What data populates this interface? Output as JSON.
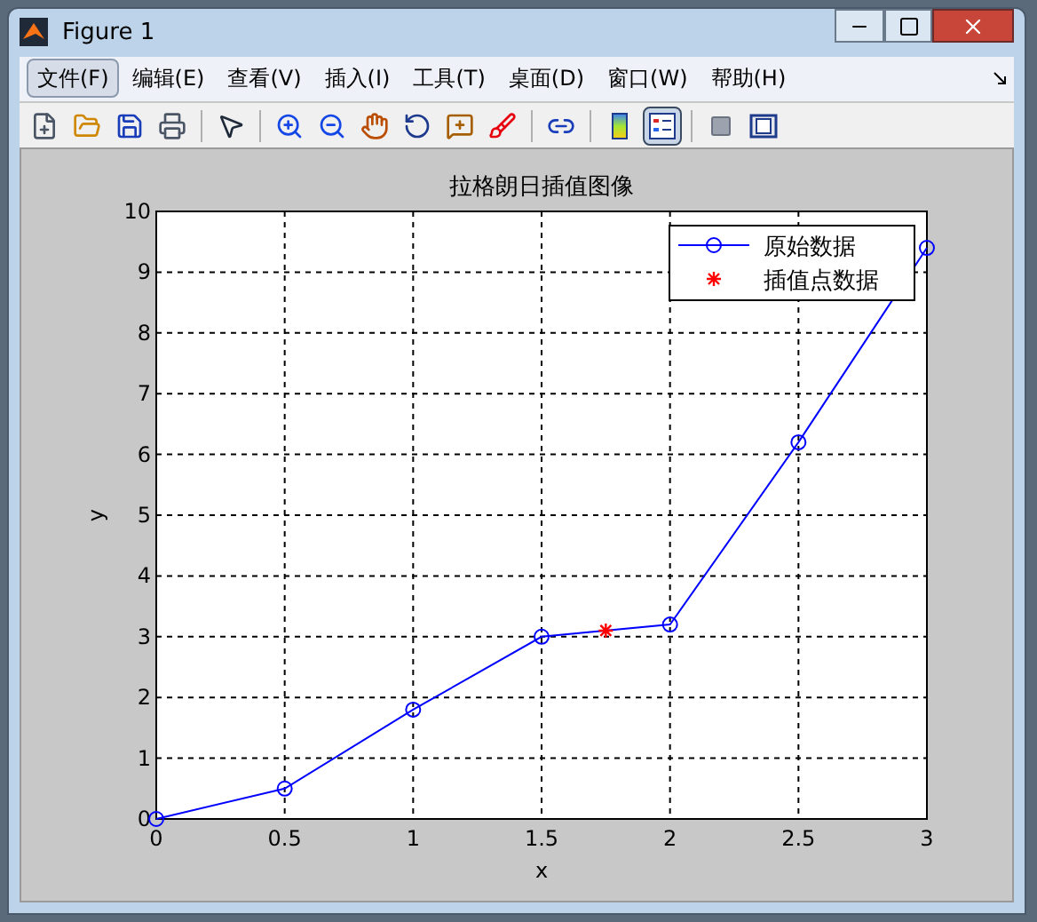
{
  "window": {
    "title": "Figure 1"
  },
  "menu": [
    {
      "label": "文件(F)",
      "selected": true
    },
    {
      "label": "编辑(E)",
      "selected": false
    },
    {
      "label": "查看(V)",
      "selected": false
    },
    {
      "label": "插入(I)",
      "selected": false
    },
    {
      "label": "工具(T)",
      "selected": false
    },
    {
      "label": "桌面(D)",
      "selected": false
    },
    {
      "label": "窗口(W)",
      "selected": false
    },
    {
      "label": "帮助(H)",
      "selected": false
    }
  ],
  "toolbar": [
    [
      {
        "kind": "new",
        "on": false
      },
      {
        "kind": "open",
        "on": false
      },
      {
        "kind": "save",
        "on": false
      },
      {
        "kind": "print",
        "on": false
      }
    ],
    [
      {
        "kind": "pointer",
        "on": false
      }
    ],
    [
      {
        "kind": "zoomin",
        "on": false
      },
      {
        "kind": "zoomout",
        "on": false
      },
      {
        "kind": "pan",
        "on": false
      },
      {
        "kind": "rotate",
        "on": false
      },
      {
        "kind": "cursor",
        "on": false
      },
      {
        "kind": "brush",
        "on": false
      }
    ],
    [
      {
        "kind": "link",
        "on": false
      }
    ],
    [
      {
        "kind": "colorbar",
        "on": false
      },
      {
        "kind": "legend",
        "on": true
      }
    ],
    [
      {
        "kind": "hide",
        "on": false
      },
      {
        "kind": "show",
        "on": false
      }
    ]
  ],
  "chart_data": {
    "type": "line",
    "grid": true,
    "legend": true,
    "title": "拉格朗日插值图像",
    "xlabel": "x",
    "ylabel": "y",
    "xlim": [
      0,
      3
    ],
    "ylim": [
      0,
      10
    ],
    "xticks": [
      0,
      0.5,
      1,
      1.5,
      2,
      2.5,
      3
    ],
    "yticks": [
      0,
      1,
      2,
      3,
      4,
      5,
      6,
      7,
      8,
      9,
      10
    ],
    "series": [
      {
        "name": "原始数据",
        "color": "#0000ff",
        "marker": "circle",
        "x": [
          0,
          0.5,
          1,
          1.5,
          2,
          2.5,
          3
        ],
        "values": [
          0,
          0.5,
          1.8,
          3.0,
          3.2,
          6.2,
          9.4
        ]
      },
      {
        "name": "插值点数据",
        "color": "#ff0000",
        "marker": "cross",
        "x": [
          1.75
        ],
        "values": [
          3.1
        ]
      }
    ]
  }
}
